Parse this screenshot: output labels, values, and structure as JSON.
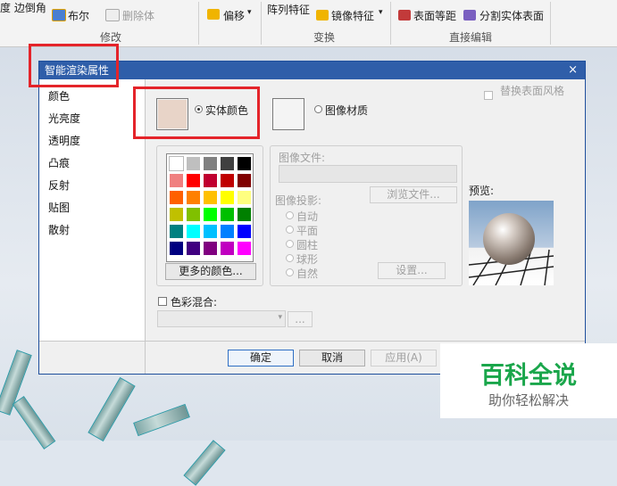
{
  "ribbon": {
    "row1_left_label": "度 边倒角",
    "bool_label": "布尔",
    "delete_body_label": "删除体",
    "offset_label": "偏移",
    "pattern_feature_label": "阵列特征",
    "mirror_feature_label": "镜像特征",
    "offset_region_label": "表面等距",
    "split_body_label": "分割实体表面",
    "group_modify": "修改",
    "group_transform": "变换",
    "group_direct_edit": "直接编辑"
  },
  "dialog": {
    "title": "智能渲染属性",
    "close_glyph": "×",
    "sidebar": [
      "颜色",
      "光亮度",
      "透明度",
      "凸痕",
      "反射",
      "贴图",
      "散射"
    ],
    "replace_surface_style": "替换表面风格",
    "solid_color_label": "实体颜色",
    "image_material_label": "图像材质",
    "image_file_label": "图像文件:",
    "browse_file": "浏览文件...",
    "image_projection_label": "图像投影:",
    "projections": [
      "自动",
      "平面",
      "圆柱",
      "球形",
      "自然"
    ],
    "settings": "设置...",
    "preview_label": "预览:",
    "more_colors": "更多的颜色...",
    "color_blend_label": "色彩混合:",
    "blend_button": "...",
    "ok": "确定",
    "cancel": "取消",
    "apply": "应用(A)",
    "swatch_color": "#e8d4c8",
    "palette": [
      [
        "#ffffff",
        "#bfbfbf",
        "#808080",
        "#404040",
        "#000000"
      ],
      [
        "#f08080",
        "#ff0000",
        "#c00030",
        "#c00000",
        "#800000"
      ],
      [
        "#ff6000",
        "#ff8000",
        "#ffc000",
        "#ffff00",
        "#ffff80"
      ],
      [
        "#c0c000",
        "#80c000",
        "#00ff00",
        "#00c000",
        "#008000"
      ],
      [
        "#008080",
        "#00ffff",
        "#00c0ff",
        "#0080ff",
        "#0000ff"
      ],
      [
        "#000080",
        "#400080",
        "#800080",
        "#c000c0",
        "#ff00ff"
      ]
    ]
  },
  "watermark": {
    "title": "百科全说",
    "subtitle": "助你轻松解决"
  },
  "colors": {
    "accent": "#2f5ea9",
    "highlight": "#e4242a",
    "watermark_green": "#1aa64b"
  }
}
